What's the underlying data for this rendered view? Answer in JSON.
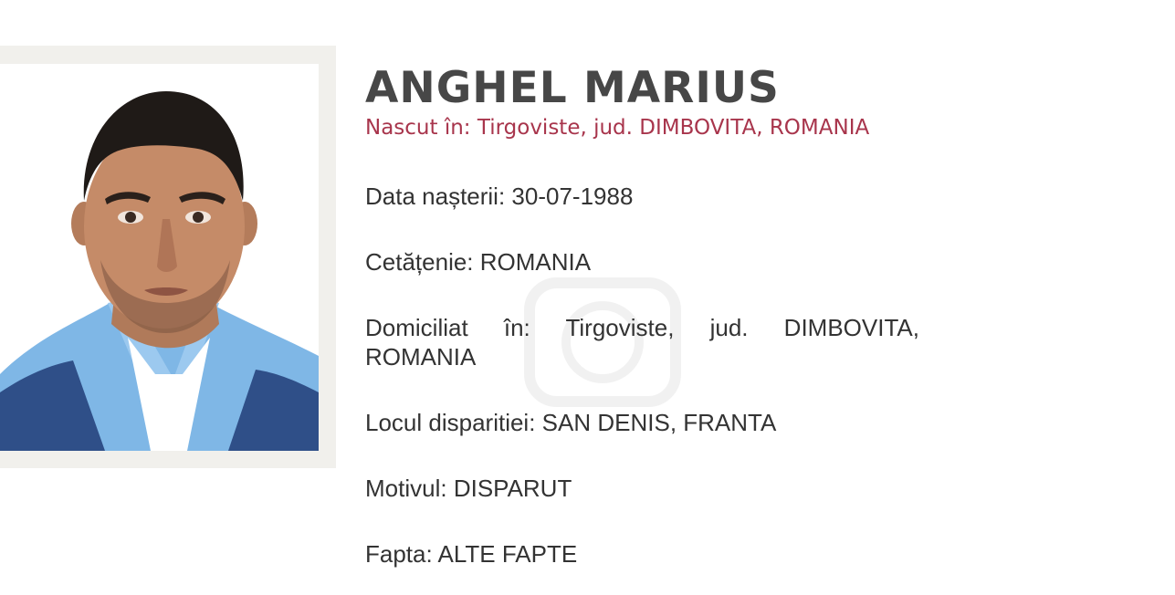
{
  "person": {
    "name": "ANGHEL MARIUS",
    "birthplace": "Nascut în: Tirgoviste, jud. DIMBOVITA, ROMANIA"
  },
  "details": [
    {
      "label": "Data nașterii:",
      "value": "30-07-1988"
    },
    {
      "label": "Cetățenie:",
      "value": "ROMANIA"
    },
    {
      "label": "Domiciliat în:",
      "value": "Tirgoviste, jud. DIMBOVITA, ROMANIA"
    },
    {
      "label": "Locul disparitiei:",
      "value": "SAN DENIS, FRANTA"
    },
    {
      "label": "Motivul:",
      "value": "DISPARUT"
    },
    {
      "label": "Fapta:",
      "value": "ALTE FAPTE"
    }
  ],
  "colors": {
    "name": "#474747",
    "birthplace": "#a8354c",
    "text": "#333333",
    "frame": "#f1f0ec"
  },
  "icons": {
    "photo": "person-portrait-photo",
    "watermark": "watermark-logo"
  }
}
